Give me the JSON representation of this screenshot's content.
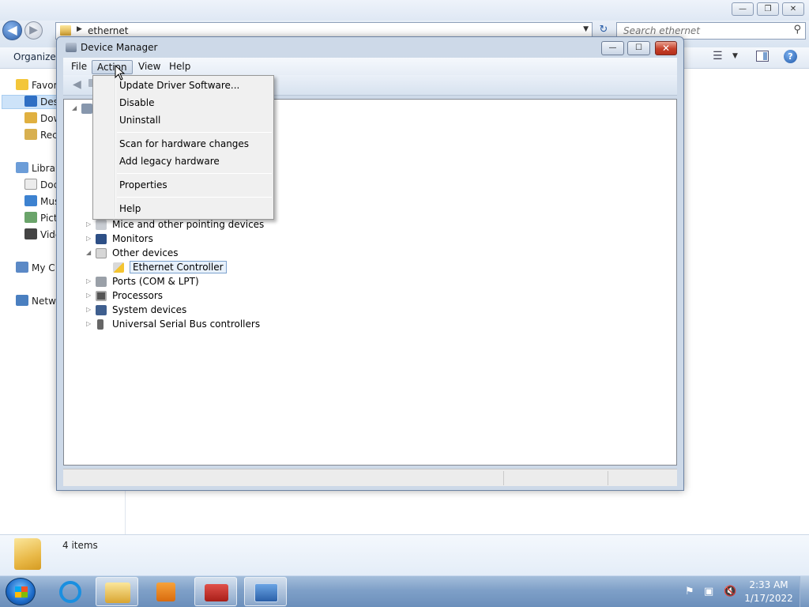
{
  "explorer": {
    "address_crumb": "ethernet",
    "search_placeholder": "Search ethernet",
    "organize_label": "Organize",
    "nav_items": [
      "Favor",
      "Des",
      "Dow",
      "Rec",
      "Librar",
      "Doc",
      "Mus",
      "Pict",
      "Vide",
      "My C",
      "Netw"
    ],
    "item_count": "4 items",
    "caption_minimize": "—",
    "caption_restore": "❐",
    "caption_close": "✕"
  },
  "device_manager": {
    "title": "Device Manager",
    "close_glyph": "✕",
    "minimize_glyph": "—",
    "maximize_glyph": "☐",
    "menu": {
      "file": "File",
      "action": "Action",
      "view": "View",
      "help": "Help"
    },
    "tree": {
      "mice": "Mice and other pointing devices",
      "monitors": "Monitors",
      "other_devices": "Other devices",
      "ethernet_controller": "Ethernet Controller",
      "ports": "Ports (COM & LPT)",
      "processors": "Processors",
      "system_devices": "System devices",
      "usb": "Universal Serial Bus controllers"
    }
  },
  "action_menu": {
    "update_driver": "Update Driver Software...",
    "disable": "Disable",
    "uninstall": "Uninstall",
    "scan": "Scan for hardware changes",
    "add_legacy": "Add legacy hardware",
    "properties": "Properties",
    "help": "Help"
  },
  "taskbar": {
    "time": "2:33 AM",
    "date": "1/17/2022"
  },
  "colors": {
    "taskbar": "#7fa0c8",
    "selection": "#cde3f9",
    "close_red": "#c6402a",
    "menu_bg": "#f0f0f0"
  }
}
